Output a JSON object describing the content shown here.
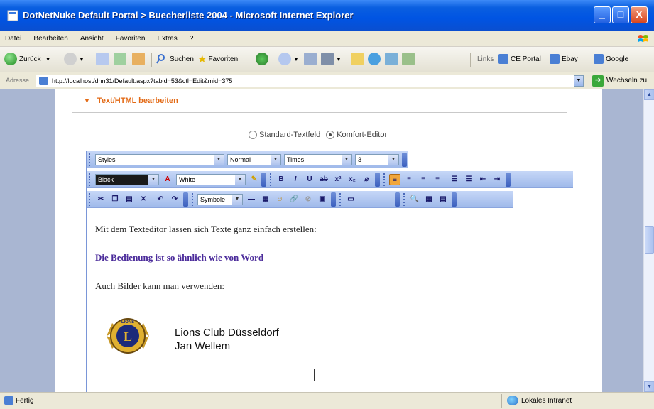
{
  "window": {
    "title": "DotNetNuke Default Portal > Buecherliste 2004 - Microsoft Internet Explorer",
    "minimize": "_",
    "maximize": "□",
    "close": "X"
  },
  "menubar": {
    "items": [
      "Datei",
      "Bearbeiten",
      "Ansicht",
      "Favoriten",
      "Extras",
      "?"
    ]
  },
  "toolbar": {
    "back": "Zurück",
    "search": "Suchen",
    "favorites": "Favoriten",
    "links_label": "Links",
    "links": [
      "CE Portal",
      "Ebay",
      "Google"
    ]
  },
  "addressbar": {
    "label": "Adresse",
    "url": "http://localhost/dnn31/Default.aspx?tabid=53&ctl=Edit&mid=375",
    "go_label": "Wechseln zu"
  },
  "page": {
    "section_title": "Text/HTML bearbeiten",
    "radio_standard": "Standard-Textfeld",
    "radio_comfort": "Komfort-Editor",
    "editor": {
      "styles": "Styles",
      "paragraph": "Normal",
      "font": "Times",
      "size": "3",
      "forecolor": "Black",
      "backcolor": "White",
      "symbols": "Symbole",
      "content_p1": "Mit dem Texteditor lassen sich Texte ganz einfach erstellen:",
      "content_p2": "Die Bedienung ist so ähnlich wie von Word",
      "content_p3": "Auch Bilder kann man verwenden:",
      "logo_text": "LIONS",
      "logo_letter": "L",
      "image_line1": "Lions Club Düsseldorf",
      "image_line2": "Jan Wellem"
    }
  },
  "statusbar": {
    "status": "Fertig",
    "zone": "Lokales Intranet"
  },
  "colors": {
    "title_blue": "#0054e3",
    "section_orange": "#e36a16",
    "word_purple": "#4a2a9a",
    "editor_toolbar": "#b8cdf2"
  }
}
